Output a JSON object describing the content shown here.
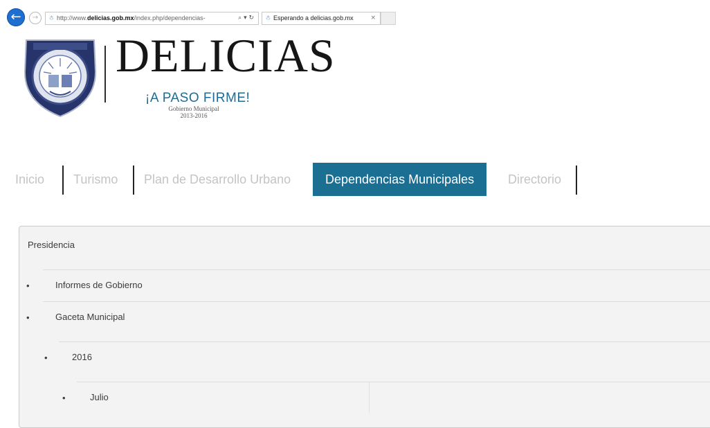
{
  "browser": {
    "address": {
      "prefix": "http://www.",
      "domain": "delicias.gob.mx",
      "path": "/index.php/dependencias-",
      "tools": "⌕ ▾ ↻"
    },
    "tab": {
      "title": "Esperando a delicias.gob.mx",
      "close": "×"
    }
  },
  "header": {
    "brand_name": "DELICIAS",
    "slogan": "¡A PASO FIRME!",
    "gov_line1": "Gobierno Municipal",
    "gov_line2": "2013-2016"
  },
  "nav": {
    "items": [
      {
        "label": "Inicio"
      },
      {
        "label": "Turismo"
      },
      {
        "label": "Plan de Desarrollo Urbano"
      },
      {
        "label": "Dependencias Municipales"
      },
      {
        "label": "Directorio"
      }
    ]
  },
  "content": {
    "section_title": "Presidencia",
    "items": [
      {
        "label": "Informes de Gobierno"
      },
      {
        "label": "Gaceta Municipal"
      },
      {
        "label": "2016"
      },
      {
        "label": "Julio"
      }
    ],
    "bullet": "•"
  },
  "colors": {
    "nav_active_bg": "#1b6f92",
    "slogan": "#1f6a93",
    "back_button": "#1e6fd0"
  },
  "icons": {
    "back": "back-arrow-icon",
    "forward": "forward-arrow-icon",
    "page": "page-icon",
    "close": "close-icon"
  }
}
